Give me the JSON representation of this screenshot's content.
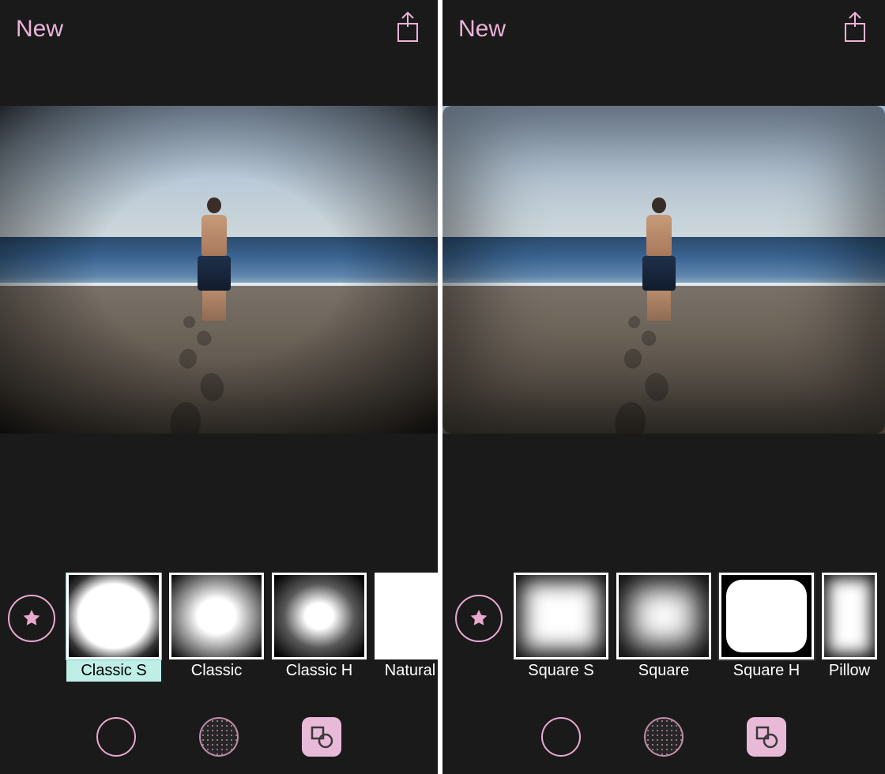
{
  "colors": {
    "accent": "#ecb3d8",
    "selectedCaptionBg": "#bfeee7"
  },
  "photo": {
    "description": "boy-on-beach",
    "filterLeft": "Classic S",
    "filterRight": "Square H"
  },
  "left": {
    "topbar": {
      "newLabel": "New",
      "shareIcon": "share-icon"
    },
    "favIcon": "star-icon",
    "filters": [
      {
        "label": "Classic S",
        "thumbClass": "t-classic-s",
        "selected": true
      },
      {
        "label": "Classic",
        "thumbClass": "t-classic",
        "selected": false
      },
      {
        "label": "Classic H",
        "thumbClass": "t-classic-h",
        "selected": false
      },
      {
        "label": "Natural",
        "thumbClass": "t-natural",
        "selected": false
      }
    ],
    "tools": {
      "vignetteShape": "circle-outline-icon",
      "grain": "dotted-circle-icon",
      "shapes": "shapes-icon",
      "shapesSelected": true
    }
  },
  "right": {
    "topbar": {
      "newLabel": "New",
      "shareIcon": "share-icon"
    },
    "favIcon": "star-icon",
    "filters": [
      {
        "label": "",
        "thumbClass": "t-partial",
        "selected": false,
        "partial": true
      },
      {
        "label": "Square S",
        "thumbClass": "t-square-s",
        "selected": false
      },
      {
        "label": "Square",
        "thumbClass": "t-square",
        "selected": false
      },
      {
        "label": "Square H",
        "thumbClass": "t-square-h",
        "selected": true
      },
      {
        "label": "Pillow",
        "thumbClass": "t-pillow",
        "selected": false,
        "partial": true
      }
    ],
    "tools": {
      "vignetteShape": "circle-outline-icon",
      "grain": "dotted-circle-icon",
      "shapes": "shapes-icon",
      "shapesSelected": true
    }
  }
}
